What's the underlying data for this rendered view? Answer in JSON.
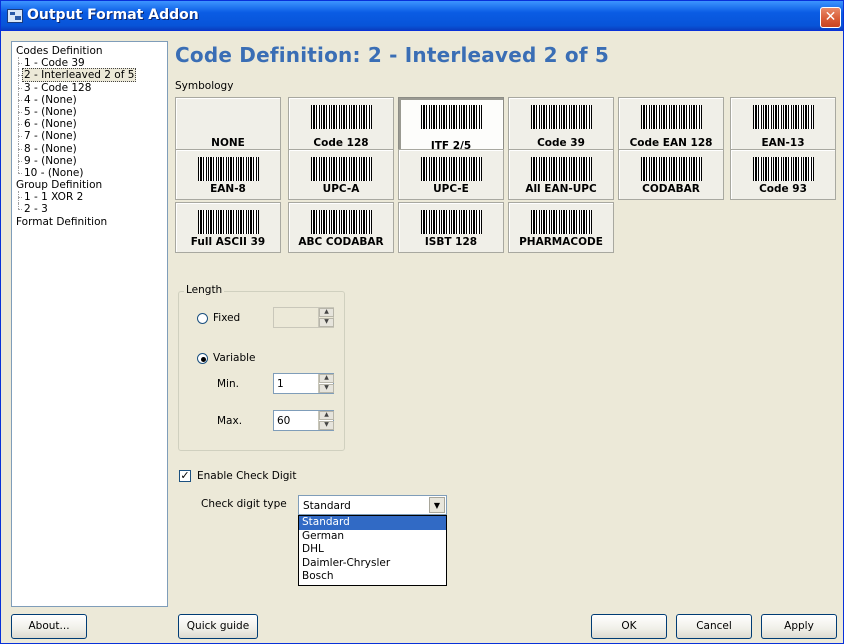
{
  "window": {
    "title": "Output Format Addon",
    "close_glyph": "✕"
  },
  "tree": {
    "items": [
      {
        "label": "Codes Definition",
        "level": 0
      },
      {
        "label": "1 - Code 39",
        "level": 1
      },
      {
        "label": "2 - Interleaved 2 of 5",
        "level": 1,
        "selected": true
      },
      {
        "label": "3 - Code 128",
        "level": 1
      },
      {
        "label": "4 - (None)",
        "level": 1
      },
      {
        "label": "5 - (None)",
        "level": 1
      },
      {
        "label": "6 - (None)",
        "level": 1
      },
      {
        "label": "7 - (None)",
        "level": 1
      },
      {
        "label": "8 - (None)",
        "level": 1
      },
      {
        "label": "9 - (None)",
        "level": 1
      },
      {
        "label": "10 - (None)",
        "level": 1,
        "last": true
      },
      {
        "label": "Group Definition",
        "level": 0
      },
      {
        "label": "1 - 1 XOR 2",
        "level": 1
      },
      {
        "label": "2 - 3",
        "level": 1,
        "last": true
      },
      {
        "label": "Format Definition",
        "level": 0
      }
    ]
  },
  "main": {
    "heading": "Code Definition: 2 - Interleaved 2 of 5",
    "symbology_label": "Symbology",
    "symbologies": [
      {
        "label": "NONE",
        "barcode": false
      },
      {
        "label": "Code 128",
        "barcode": true
      },
      {
        "label": "ITF 2/5",
        "barcode": true,
        "selected": true
      },
      {
        "label": "Code 39",
        "barcode": true
      },
      {
        "label": "Code EAN 128",
        "barcode": true
      },
      {
        "label": "EAN-13",
        "barcode": true
      },
      {
        "label": "EAN-8",
        "barcode": true
      },
      {
        "label": "UPC-A",
        "barcode": true
      },
      {
        "label": "UPC-E",
        "barcode": true
      },
      {
        "label": "All EAN-UPC",
        "barcode": true
      },
      {
        "label": "CODABAR",
        "barcode": true
      },
      {
        "label": "Code 93",
        "barcode": true
      },
      {
        "label": "Full ASCII 39",
        "barcode": true
      },
      {
        "label": "ABC CODABAR",
        "barcode": true
      },
      {
        "label": "ISBT 128",
        "barcode": true
      },
      {
        "label": "PHARMACODE",
        "barcode": true
      }
    ],
    "length": {
      "title": "Length",
      "fixed_label": "Fixed",
      "fixed_value": "",
      "variable_label": "Variable",
      "selected": "variable",
      "min_label": "Min.",
      "min_value": "1",
      "max_label": "Max.",
      "max_value": "60"
    },
    "check_digit": {
      "enable_label": "Enable Check Digit",
      "enabled": true,
      "type_label": "Check digit type",
      "type_value": "Standard",
      "options": [
        "Standard",
        "German",
        "DHL",
        "Daimler-Chrysler",
        "Bosch"
      ],
      "highlighted": "Standard"
    }
  },
  "buttons": {
    "about": "About...",
    "quick_guide": "Quick guide",
    "ok": "OK",
    "cancel": "Cancel",
    "apply": "Apply"
  }
}
